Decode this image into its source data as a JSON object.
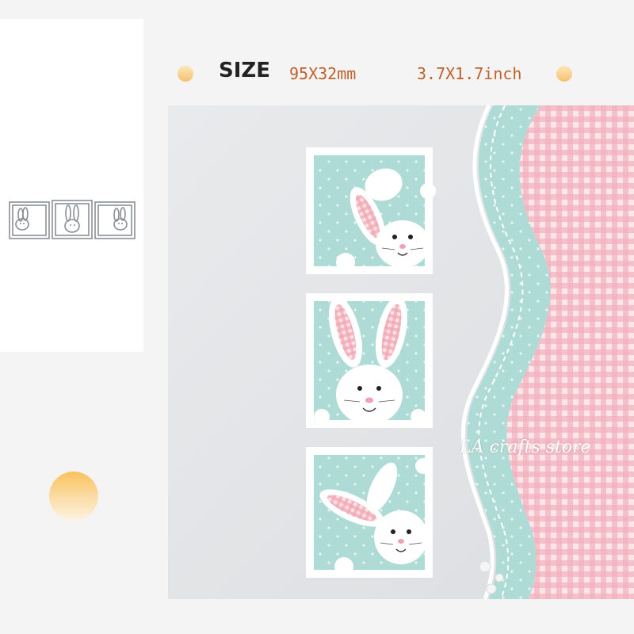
{
  "size_info": {
    "label": "SIZE",
    "metric": "95X32mm",
    "imperial": "3.7X1.7inch"
  },
  "watermark": "LA crafts store",
  "colors": {
    "accent_orange": "#c0602a",
    "mint": "#a9dcd6",
    "gingham_pink": "#f2a9b4",
    "dot_gold": "#f6c070"
  }
}
